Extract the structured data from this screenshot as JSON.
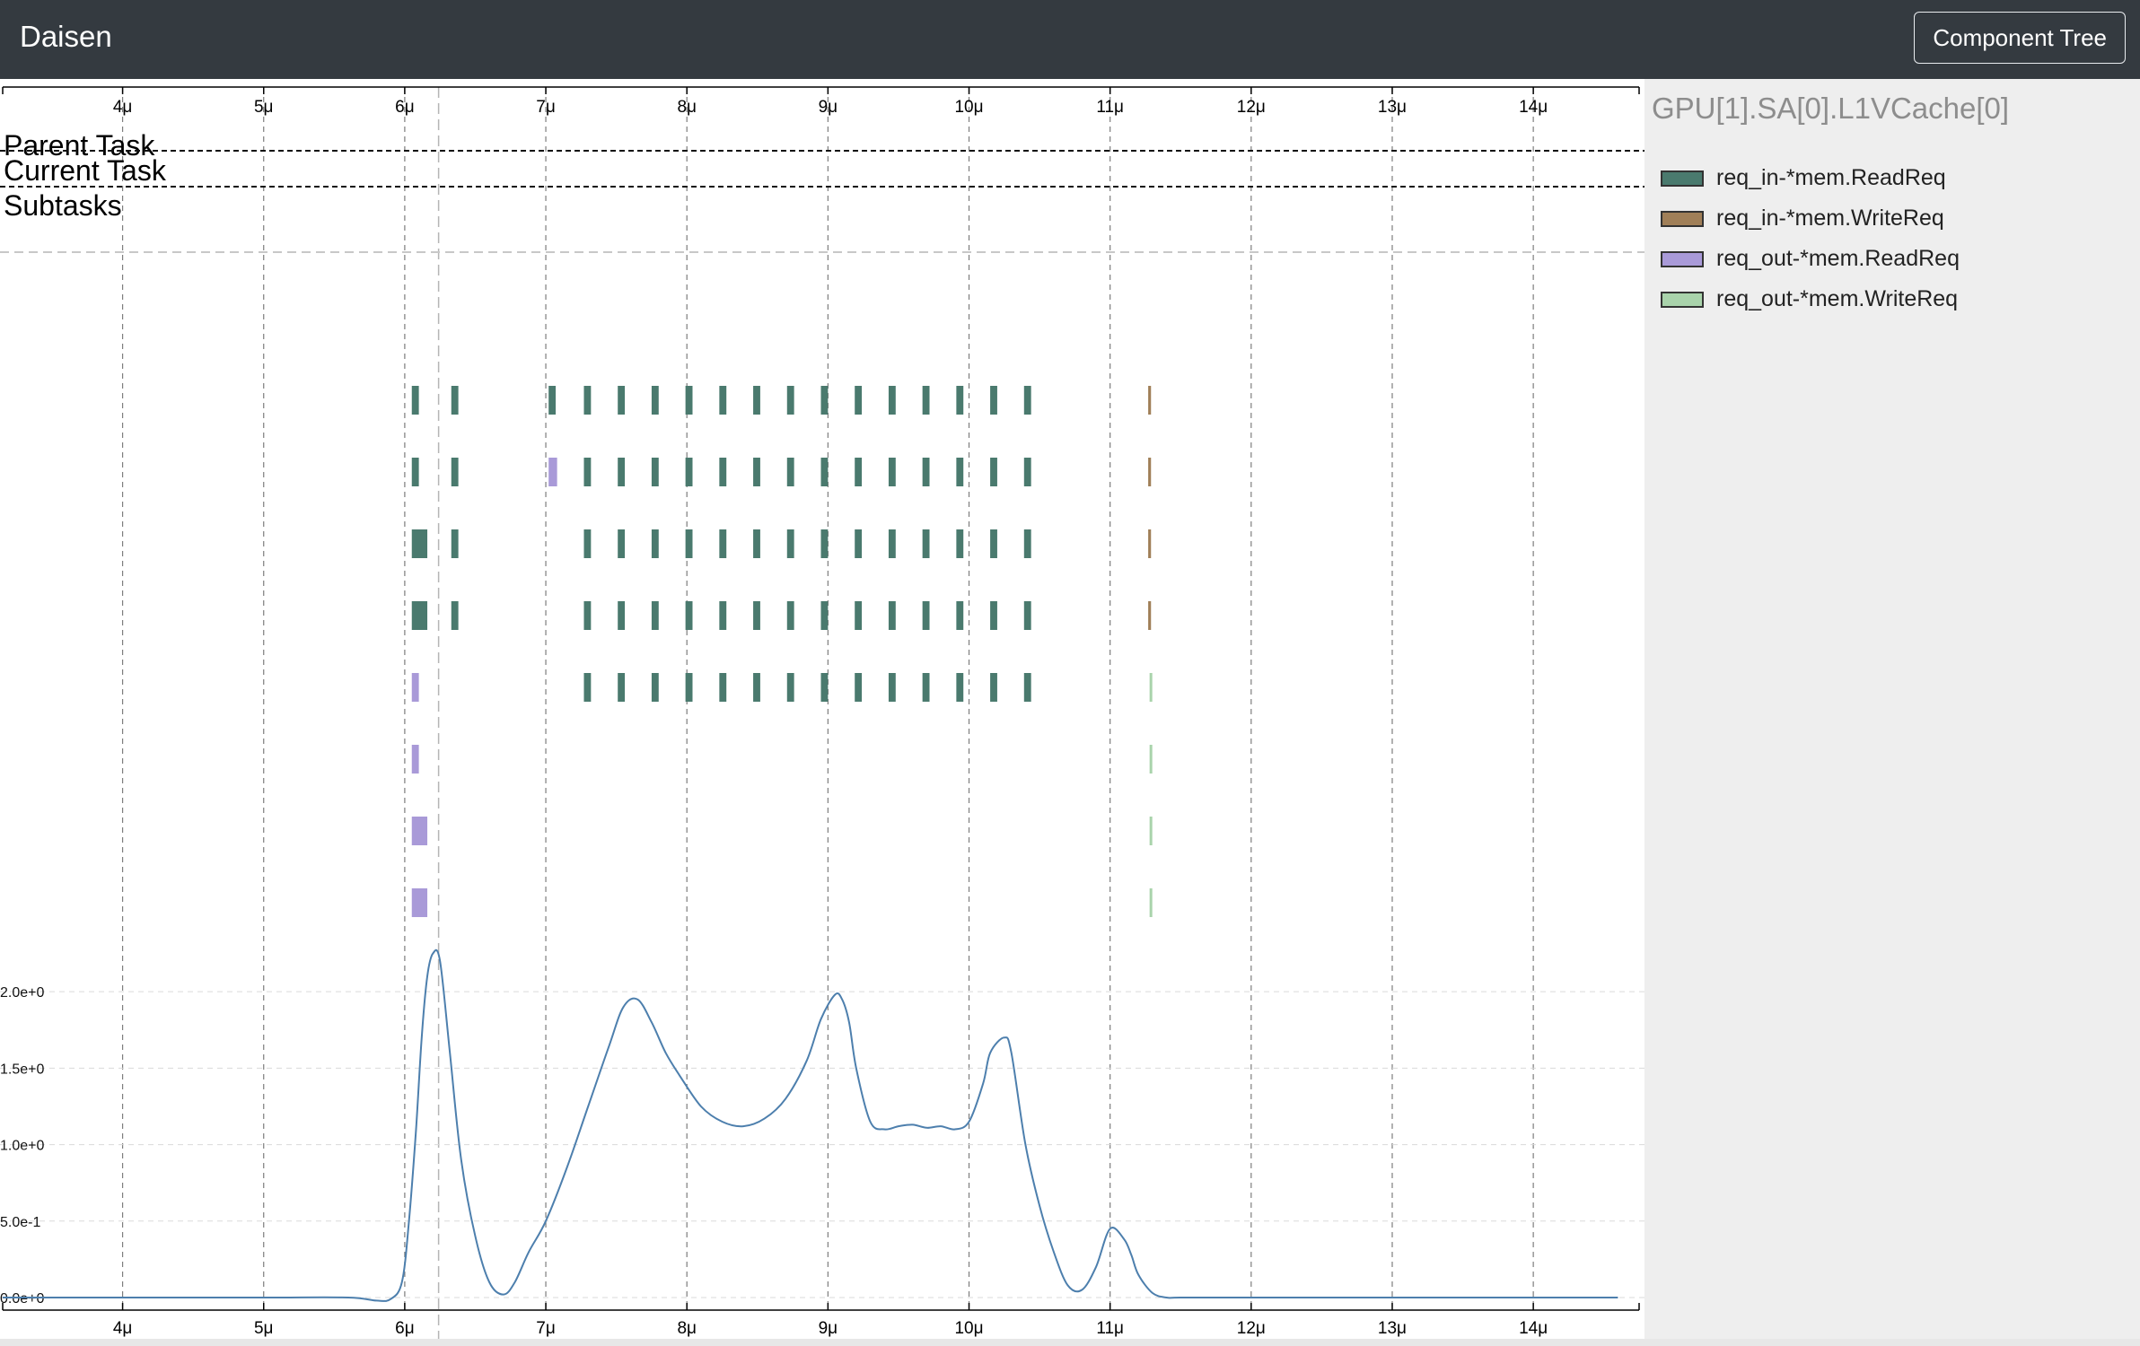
{
  "navbar": {
    "brand": "Daisen",
    "component_tree_label": "Component Tree"
  },
  "timeline": {
    "parent_task_label": "Parent Task",
    "current_task_label": "Current Task",
    "subtasks_label": "Subtasks",
    "x_ticks": [
      {
        "value": 4,
        "label": "4μ"
      },
      {
        "value": 5,
        "label": "5μ"
      },
      {
        "value": 6,
        "label": "6μ"
      },
      {
        "value": 7,
        "label": "7μ"
      },
      {
        "value": 8,
        "label": "8μ"
      },
      {
        "value": 9,
        "label": "9μ"
      },
      {
        "value": 10,
        "label": "10μ"
      },
      {
        "value": 11,
        "label": "11μ"
      },
      {
        "value": 12,
        "label": "12μ"
      },
      {
        "value": 13,
        "label": "13μ"
      },
      {
        "value": 14,
        "label": "14μ"
      }
    ],
    "x_range": [
      3.15,
      14.75
    ],
    "cursor_time": 6.24
  },
  "sidebar": {
    "component_name": "GPU[1].SA[0].L1VCache[0]",
    "legend": [
      {
        "label": "req_in-*mem.ReadReq",
        "color": "#4a7a6e"
      },
      {
        "label": "req_in-*mem.WriteReq",
        "color": "#a07f58"
      },
      {
        "label": "req_out-*mem.ReadReq",
        "color": "#a99ad8"
      },
      {
        "label": "req_out-*mem.WriteReq",
        "color": "#a9d3ab"
      }
    ]
  },
  "tasks": {
    "rows": [
      [
        {
          "s": 6.05,
          "e": 6.1,
          "k": 0
        },
        {
          "s": 6.33,
          "e": 6.38,
          "k": 0
        },
        {
          "s": 7.02,
          "e": 7.07,
          "k": 0
        },
        {
          "s": 7.27,
          "e": 7.32,
          "k": 0
        },
        {
          "s": 7.51,
          "e": 7.56,
          "k": 0
        },
        {
          "s": 7.75,
          "e": 7.8,
          "k": 0
        },
        {
          "s": 7.99,
          "e": 8.04,
          "k": 0
        },
        {
          "s": 8.23,
          "e": 8.28,
          "k": 0
        },
        {
          "s": 8.47,
          "e": 8.52,
          "k": 0
        },
        {
          "s": 8.71,
          "e": 8.76,
          "k": 0
        },
        {
          "s": 8.95,
          "e": 9.0,
          "k": 0
        },
        {
          "s": 9.19,
          "e": 9.24,
          "k": 0
        },
        {
          "s": 9.43,
          "e": 9.48,
          "k": 0
        },
        {
          "s": 9.67,
          "e": 9.72,
          "k": 0
        },
        {
          "s": 9.91,
          "e": 9.96,
          "k": 0
        },
        {
          "s": 10.15,
          "e": 10.2,
          "k": 0
        },
        {
          "s": 10.39,
          "e": 10.44,
          "k": 0
        },
        {
          "s": 11.27,
          "e": 11.29,
          "k": 1
        }
      ],
      [
        {
          "s": 6.05,
          "e": 6.1,
          "k": 0
        },
        {
          "s": 6.33,
          "e": 6.38,
          "k": 0
        },
        {
          "s": 7.02,
          "e": 7.08,
          "k": 2
        },
        {
          "s": 7.27,
          "e": 7.32,
          "k": 0
        },
        {
          "s": 7.51,
          "e": 7.56,
          "k": 0
        },
        {
          "s": 7.75,
          "e": 7.8,
          "k": 0
        },
        {
          "s": 7.99,
          "e": 8.04,
          "k": 0
        },
        {
          "s": 8.23,
          "e": 8.28,
          "k": 0
        },
        {
          "s": 8.47,
          "e": 8.52,
          "k": 0
        },
        {
          "s": 8.71,
          "e": 8.76,
          "k": 0
        },
        {
          "s": 8.95,
          "e": 9.0,
          "k": 0
        },
        {
          "s": 9.19,
          "e": 9.24,
          "k": 0
        },
        {
          "s": 9.43,
          "e": 9.48,
          "k": 0
        },
        {
          "s": 9.67,
          "e": 9.72,
          "k": 0
        },
        {
          "s": 9.91,
          "e": 9.96,
          "k": 0
        },
        {
          "s": 10.15,
          "e": 10.2,
          "k": 0
        },
        {
          "s": 10.39,
          "e": 10.44,
          "k": 0
        },
        {
          "s": 11.27,
          "e": 11.29,
          "k": 1
        }
      ],
      [
        {
          "s": 6.05,
          "e": 6.16,
          "k": 0
        },
        {
          "s": 6.33,
          "e": 6.38,
          "k": 0
        },
        {
          "s": 7.27,
          "e": 7.32,
          "k": 0
        },
        {
          "s": 7.51,
          "e": 7.56,
          "k": 0
        },
        {
          "s": 7.75,
          "e": 7.8,
          "k": 0
        },
        {
          "s": 7.99,
          "e": 8.04,
          "k": 0
        },
        {
          "s": 8.23,
          "e": 8.28,
          "k": 0
        },
        {
          "s": 8.47,
          "e": 8.52,
          "k": 0
        },
        {
          "s": 8.71,
          "e": 8.76,
          "k": 0
        },
        {
          "s": 8.95,
          "e": 9.0,
          "k": 0
        },
        {
          "s": 9.19,
          "e": 9.24,
          "k": 0
        },
        {
          "s": 9.43,
          "e": 9.48,
          "k": 0
        },
        {
          "s": 9.67,
          "e": 9.72,
          "k": 0
        },
        {
          "s": 9.91,
          "e": 9.96,
          "k": 0
        },
        {
          "s": 10.15,
          "e": 10.2,
          "k": 0
        },
        {
          "s": 10.39,
          "e": 10.44,
          "k": 0
        },
        {
          "s": 11.27,
          "e": 11.29,
          "k": 1
        }
      ],
      [
        {
          "s": 6.05,
          "e": 6.16,
          "k": 0
        },
        {
          "s": 6.33,
          "e": 6.38,
          "k": 0
        },
        {
          "s": 7.27,
          "e": 7.32,
          "k": 0
        },
        {
          "s": 7.51,
          "e": 7.56,
          "k": 0
        },
        {
          "s": 7.75,
          "e": 7.8,
          "k": 0
        },
        {
          "s": 7.99,
          "e": 8.04,
          "k": 0
        },
        {
          "s": 8.23,
          "e": 8.28,
          "k": 0
        },
        {
          "s": 8.47,
          "e": 8.52,
          "k": 0
        },
        {
          "s": 8.71,
          "e": 8.76,
          "k": 0
        },
        {
          "s": 8.95,
          "e": 9.0,
          "k": 0
        },
        {
          "s": 9.19,
          "e": 9.24,
          "k": 0
        },
        {
          "s": 9.43,
          "e": 9.48,
          "k": 0
        },
        {
          "s": 9.67,
          "e": 9.72,
          "k": 0
        },
        {
          "s": 9.91,
          "e": 9.96,
          "k": 0
        },
        {
          "s": 10.15,
          "e": 10.2,
          "k": 0
        },
        {
          "s": 10.39,
          "e": 10.44,
          "k": 0
        },
        {
          "s": 11.27,
          "e": 11.29,
          "k": 1
        }
      ],
      [
        {
          "s": 6.05,
          "e": 6.1,
          "k": 2
        },
        {
          "s": 7.27,
          "e": 7.32,
          "k": 0
        },
        {
          "s": 7.51,
          "e": 7.56,
          "k": 0
        },
        {
          "s": 7.75,
          "e": 7.8,
          "k": 0
        },
        {
          "s": 7.99,
          "e": 8.04,
          "k": 0
        },
        {
          "s": 8.23,
          "e": 8.28,
          "k": 0
        },
        {
          "s": 8.47,
          "e": 8.52,
          "k": 0
        },
        {
          "s": 8.71,
          "e": 8.76,
          "k": 0
        },
        {
          "s": 8.95,
          "e": 9.0,
          "k": 0
        },
        {
          "s": 9.19,
          "e": 9.24,
          "k": 0
        },
        {
          "s": 9.43,
          "e": 9.48,
          "k": 0
        },
        {
          "s": 9.67,
          "e": 9.72,
          "k": 0
        },
        {
          "s": 9.91,
          "e": 9.96,
          "k": 0
        },
        {
          "s": 10.15,
          "e": 10.2,
          "k": 0
        },
        {
          "s": 10.39,
          "e": 10.44,
          "k": 0
        },
        {
          "s": 11.28,
          "e": 11.29,
          "k": 3
        }
      ],
      [
        {
          "s": 6.05,
          "e": 6.1,
          "k": 2
        },
        {
          "s": 11.28,
          "e": 11.29,
          "k": 3
        }
      ],
      [
        {
          "s": 6.05,
          "e": 6.16,
          "k": 2
        },
        {
          "s": 11.28,
          "e": 11.29,
          "k": 3
        }
      ],
      [
        {
          "s": 6.05,
          "e": 6.16,
          "k": 2
        },
        {
          "s": 11.28,
          "e": 11.29,
          "k": 3
        }
      ]
    ]
  },
  "chart_data": {
    "type": "line",
    "y_ticks": [
      {
        "value": 0,
        "label": "0.0e+0"
      },
      {
        "value": 0.5,
        "label": "5.0e-1"
      },
      {
        "value": 1.0,
        "label": "1.0e+0"
      },
      {
        "value": 1.5,
        "label": "1.5e+0"
      },
      {
        "value": 2.0,
        "label": "2.0e+0"
      }
    ],
    "ylim": [
      0,
      2.3
    ],
    "xlim": [
      3.15,
      14.75
    ],
    "series": [
      {
        "x": [
          3.15,
          4,
          5,
          5.6,
          5.8,
          5.9,
          5.98,
          6.03,
          6.08,
          6.12,
          6.16,
          6.2,
          6.25,
          6.32,
          6.4,
          6.5,
          6.6,
          6.7,
          6.78,
          6.88,
          7.0,
          7.15,
          7.3,
          7.45,
          7.55,
          7.65,
          7.75,
          7.85,
          7.95,
          8.1,
          8.25,
          8.4,
          8.55,
          8.7,
          8.85,
          8.95,
          9.05,
          9.1,
          9.15,
          9.2,
          9.3,
          9.4,
          9.5,
          9.6,
          9.7,
          9.8,
          9.9,
          10.0,
          10.1,
          10.15,
          10.25,
          10.3,
          10.4,
          10.5,
          10.6,
          10.7,
          10.8,
          10.9,
          11.0,
          11.1,
          11.15,
          11.2,
          11.3,
          11.4,
          11.5,
          12,
          13,
          14,
          14.6
        ],
        "y": [
          0,
          0,
          0,
          0,
          -0.02,
          -0.01,
          0.1,
          0.5,
          1.1,
          1.7,
          2.1,
          2.25,
          2.2,
          1.6,
          0.9,
          0.4,
          0.1,
          0.02,
          0.1,
          0.3,
          0.5,
          0.85,
          1.25,
          1.65,
          1.9,
          1.95,
          1.8,
          1.6,
          1.45,
          1.25,
          1.15,
          1.12,
          1.17,
          1.3,
          1.55,
          1.82,
          1.98,
          1.95,
          1.8,
          1.5,
          1.15,
          1.1,
          1.12,
          1.13,
          1.11,
          1.12,
          1.1,
          1.15,
          1.4,
          1.6,
          1.7,
          1.6,
          1.0,
          0.6,
          0.3,
          0.08,
          0.05,
          0.2,
          0.45,
          0.38,
          0.28,
          0.15,
          0.03,
          0,
          0,
          0,
          0,
          0,
          0
        ]
      }
    ]
  }
}
